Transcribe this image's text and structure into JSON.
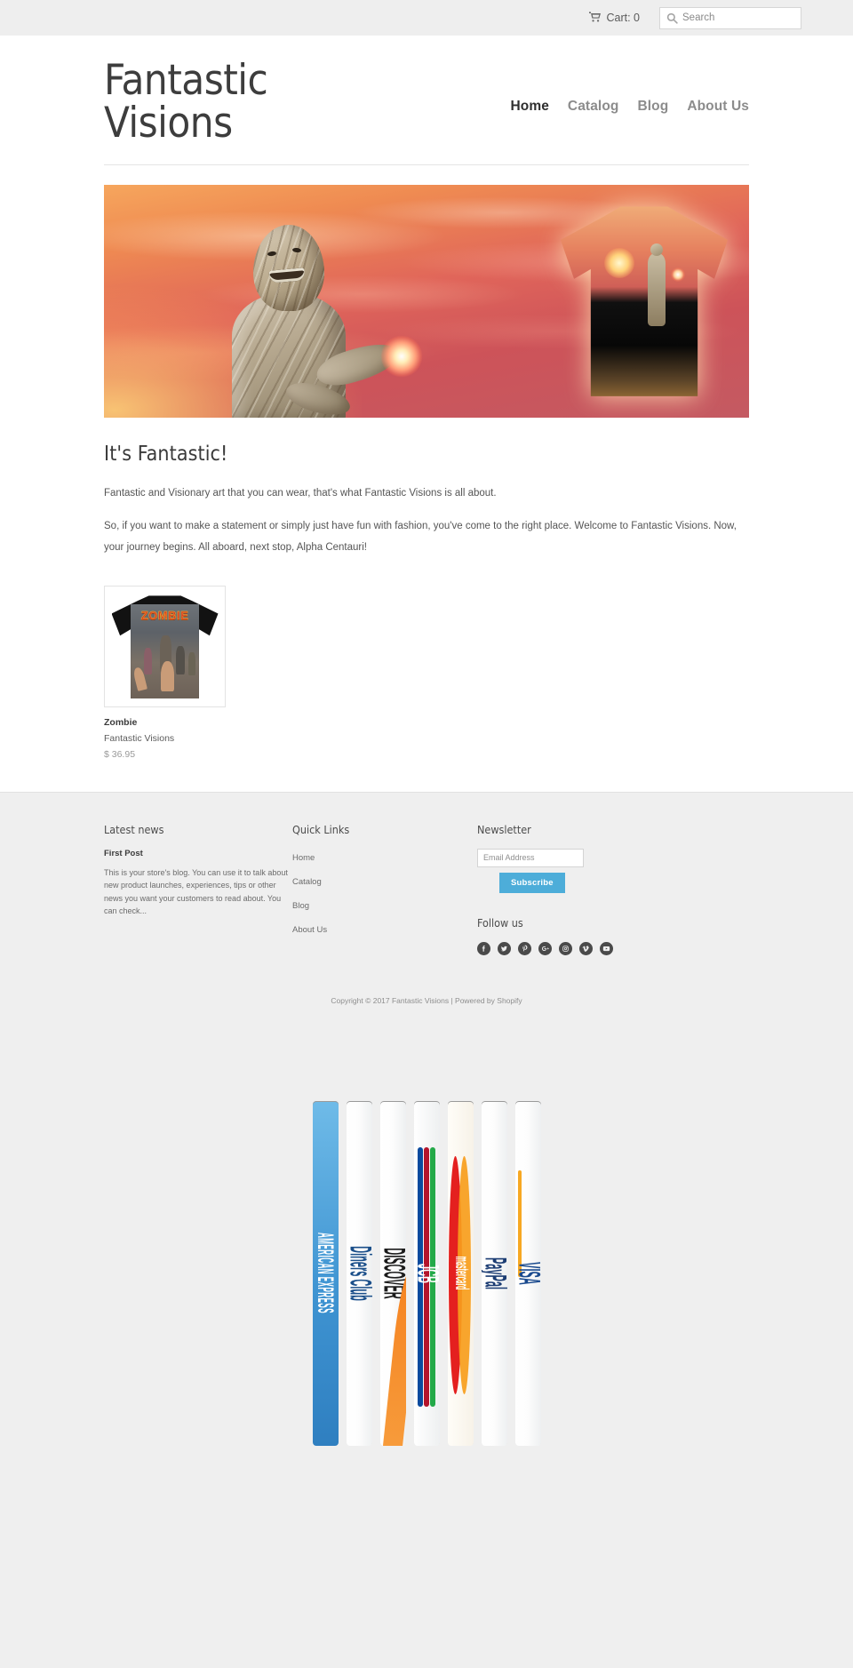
{
  "topbar": {
    "cart_label": "Cart: 0",
    "cart_icon": "shopping-cart-icon",
    "search_icon": "search-icon",
    "search_placeholder": "Search",
    "search_value": ""
  },
  "header": {
    "logo_line1": "Fantastic",
    "logo_line2": "Visions",
    "nav": [
      {
        "label": "Home",
        "active": true
      },
      {
        "label": "Catalog",
        "active": false
      },
      {
        "label": "Blog",
        "active": false
      },
      {
        "label": "About Us",
        "active": false
      }
    ]
  },
  "hero": {
    "alt": "Mummy character with glowing orb beside matching all-over-print t-shirt"
  },
  "main": {
    "heading": "It's Fantastic!",
    "paragraph1": "Fantastic and Visionary art that you can wear, that's what Fantastic Visions is all about.",
    "paragraph2": "So, if you want to make a statement or simply just have fun with fashion, you've come to the right place. Welcome to Fantastic Visions.  Now, your journey begins.  All aboard, next stop, Alpha Centauri!",
    "products": [
      {
        "name": "Zombie",
        "vendor": "Fantastic Visions",
        "price": "$ 36.95",
        "graphic_text": "ZOMBIE"
      }
    ]
  },
  "footer": {
    "news": {
      "heading": "Latest news",
      "post_title": "First Post",
      "post_excerpt": "This is your store's blog. You can use it to talk about new product launches, experiences, tips or other news you want your customers to read about. You can check..."
    },
    "quick_links": {
      "heading": "Quick Links",
      "items": [
        {
          "label": "Home"
        },
        {
          "label": "Catalog"
        },
        {
          "label": "Blog"
        },
        {
          "label": "About Us"
        }
      ]
    },
    "newsletter": {
      "heading": "Newsletter",
      "email_placeholder": "Email Address",
      "email_value": "",
      "subscribe_label": "Subscribe",
      "button_color": "#4dadd9"
    },
    "follow": {
      "heading": "Follow us",
      "socials": [
        {
          "name": "facebook-icon"
        },
        {
          "name": "twitter-icon"
        },
        {
          "name": "pinterest-icon"
        },
        {
          "name": "google-plus-icon"
        },
        {
          "name": "instagram-icon"
        },
        {
          "name": "vimeo-icon"
        },
        {
          "name": "youtube-icon"
        }
      ]
    },
    "copyright": "Copyright © 2017 Fantastic Visions | Powered by Shopify"
  },
  "payments": {
    "methods": [
      {
        "label": "AMERICAN EXPRESS",
        "key": "amex"
      },
      {
        "label": "Diners Club",
        "key": "diners"
      },
      {
        "label": "DISCOVER",
        "key": "discover"
      },
      {
        "label": "JCB",
        "key": "jcb"
      },
      {
        "label": "mastercard",
        "key": "mastercard"
      },
      {
        "label": "PayPal",
        "key": "paypal"
      },
      {
        "label": "VISA",
        "key": "visa"
      }
    ]
  }
}
